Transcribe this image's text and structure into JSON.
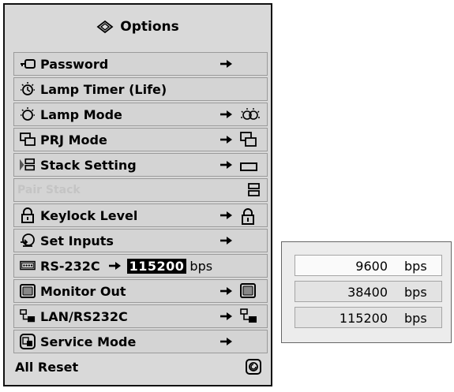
{
  "menu": {
    "title": "Options",
    "items": [
      {
        "label": "Password"
      },
      {
        "label": "Lamp Timer (Life)"
      },
      {
        "label": "Lamp Mode"
      },
      {
        "label": "PRJ Mode"
      },
      {
        "label": "Stack Setting"
      },
      {
        "label": "Pair Stack"
      },
      {
        "label": "Keylock Level"
      },
      {
        "label": "Set Inputs"
      },
      {
        "label": "RS-232C",
        "value": "115200",
        "unit": "bps"
      },
      {
        "label": "Monitor Out"
      },
      {
        "label": "LAN/RS232C"
      },
      {
        "label": "Service Mode"
      },
      {
        "label": "All Reset"
      }
    ]
  },
  "baud_popup": {
    "options": [
      {
        "value": "9600",
        "unit": "bps",
        "selected": true
      },
      {
        "value": "38400",
        "unit": "bps",
        "selected": false
      },
      {
        "value": "115200",
        "unit": "bps",
        "selected": false
      }
    ]
  },
  "icons": [
    "options-icon",
    "key-icon",
    "lamp-timer-icon",
    "lamp-icon",
    "prj-mode-icon",
    "stack-setting-icon",
    "pair-stack-icon",
    "keylock-icon",
    "set-inputs-icon",
    "rs232c-icon",
    "monitor-out-icon",
    "lan-rs232c-icon",
    "service-mode-icon",
    "reset-icon",
    "arrow-right-icon"
  ],
  "colors": {
    "panel": "#d9d9d9",
    "row": "#d4d4d4",
    "disabled_text": "#c4c4c4",
    "highlight": "#000000"
  }
}
